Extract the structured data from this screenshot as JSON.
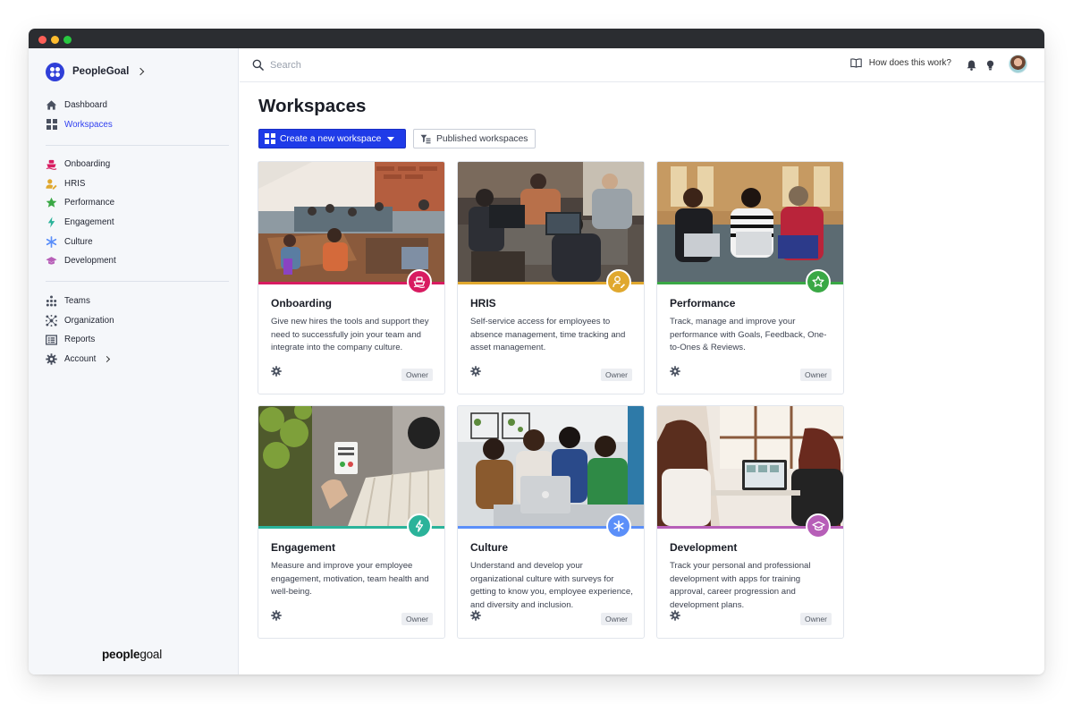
{
  "window": {
    "controls": [
      "close",
      "minimize",
      "maximize"
    ]
  },
  "brand": {
    "name": "PeopleGoal",
    "footer_bold": "people",
    "footer_light": "goal"
  },
  "sidebar": {
    "primary": [
      {
        "label": "Dashboard",
        "icon": "home-icon"
      },
      {
        "label": "Workspaces",
        "icon": "grid-icon",
        "active": true
      }
    ],
    "workspaces": [
      {
        "label": "Onboarding",
        "icon": "ship-icon",
        "color": "#d81b60"
      },
      {
        "label": "HRIS",
        "icon": "user-edit-icon",
        "color": "#e0a82e"
      },
      {
        "label": "Performance",
        "icon": "star-icon",
        "color": "#3aa845"
      },
      {
        "label": "Engagement",
        "icon": "bolt-icon",
        "color": "#2bb39a"
      },
      {
        "label": "Culture",
        "icon": "asterisk-icon",
        "color": "#5b8ff9"
      },
      {
        "label": "Development",
        "icon": "graduation-cap-icon",
        "color": "#b75fb8"
      }
    ],
    "secondary": [
      {
        "label": "Teams",
        "icon": "teams-icon"
      },
      {
        "label": "Organization",
        "icon": "organization-icon"
      },
      {
        "label": "Reports",
        "icon": "reports-icon"
      },
      {
        "label": "Account",
        "icon": "gear-icon"
      }
    ]
  },
  "topbar": {
    "search_placeholder": "Search",
    "help_label": "How does this work?"
  },
  "main": {
    "title": "Workspaces",
    "create_button": "Create a new workspace",
    "published_button": "Published workspaces"
  },
  "cards": [
    {
      "title": "Onboarding",
      "description": "Give new hires the tools and support they need to successfully join your team and integrate into the company culture.",
      "owner": "Owner",
      "color": "#d81b60",
      "icon": "ship-icon"
    },
    {
      "title": "HRIS",
      "description": "Self-service access for employees to absence management, time tracking and asset management.",
      "owner": "Owner",
      "color": "#e0a82e",
      "icon": "user-edit-icon"
    },
    {
      "title": "Performance",
      "description": "Track, manage and improve your performance with Goals, Feedback, One-to-Ones & Reviews.",
      "owner": "Owner",
      "color": "#3aa845",
      "icon": "star-icon"
    },
    {
      "title": "Engagement",
      "description": "Measure and improve your employee engagement, motivation, team health and well-being.",
      "owner": "Owner",
      "color": "#2bb39a",
      "icon": "bolt-icon"
    },
    {
      "title": "Culture",
      "description": "Understand and develop your organizational culture with surveys for getting to know you, employee experience, and diversity and inclusion.",
      "owner": "Owner",
      "color": "#5b8ff9",
      "icon": "asterisk-icon"
    },
    {
      "title": "Development",
      "description": "Track your personal and professional development with apps for training approval, career progression and development plans.",
      "owner": "Owner",
      "color": "#b75fb8",
      "icon": "graduation-cap-icon"
    }
  ]
}
